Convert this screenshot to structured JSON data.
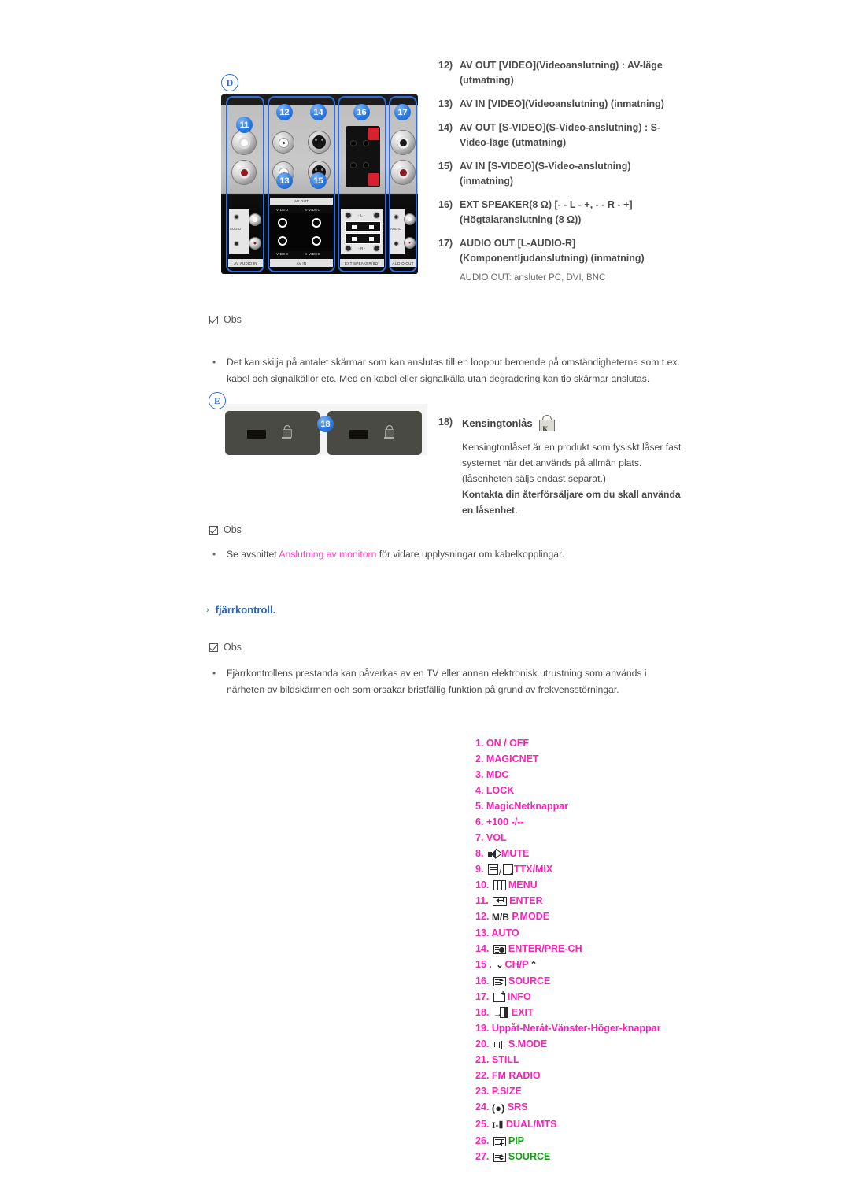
{
  "section_d": {
    "letter": "D",
    "panel": {
      "callouts": [
        "11",
        "12",
        "14",
        "16",
        "17",
        "13",
        "15"
      ],
      "labels": {
        "av_out": "AV OUT",
        "video": "VIDEO",
        "s_video": "S-VIDEO",
        "audio": "AUDIO",
        "l": "L",
        "r": "R",
        "av_audio_in": "AV AUDIO IN",
        "av_in": "AV IN",
        "ext_speaker": "EXT SPEAKER(8Ω)",
        "audio_out": "AUDIO OUT",
        "spk_l": "- L -",
        "spk_r": "- R -"
      }
    },
    "items": [
      {
        "num": "12)",
        "main": "AV OUT [VIDEO](Videoanslutning) : AV-läge",
        "cont": "(utmatning)"
      },
      {
        "num": "13)",
        "main": "AV IN [VIDEO](Videoanslutning) (inmatning)",
        "cont": ""
      },
      {
        "num": "14)",
        "main": "AV OUT [S-VIDEO](S-Video-anslutning) : S-",
        "cont": "Video-läge (utmatning)"
      },
      {
        "num": "15)",
        "main": "AV IN [S-VIDEO](S-Video-anslutning)",
        "cont": "(inmatning)"
      },
      {
        "num": "16)",
        "main": "EXT SPEAKER(8 Ω) [- - L - +, - - R - +]",
        "cont": "(Högtalaranslutning (8 Ω))"
      },
      {
        "num": "17)",
        "main": "AUDIO OUT [L-AUDIO-R]",
        "cont": "(Komponentljudanslutning) (inmatning)",
        "subnote": "AUDIO OUT: ansluter PC, DVI, BNC"
      }
    ]
  },
  "note_1": {
    "label": "Obs",
    "bullet": "•",
    "line1": "Det kan skilja på antalet skärmar som kan anslutas till en loopout beroende på omständigheterna som t.ex.",
    "line2": "kabel och signalkällor etc. Med en kabel eller signalkälla utan degradering kan tio skärmar anslutas."
  },
  "section_e": {
    "letter": "E",
    "callout": "18",
    "item": {
      "num": "18)",
      "title": "Kensingtonlås",
      "lock_icon": "kensington-lock-icon",
      "p1": "Kensingtonlåset är en produkt som fysiskt låser fast",
      "p2": "systemet när det används på allmän plats.",
      "p3": "(låsenheten säljs endast separat.)",
      "bold1": "Kontakta din återförsäljare om du skall använda",
      "bold2": "en låsenhet."
    }
  },
  "note_2": {
    "label": "Obs",
    "bullet": "•",
    "pre": "Se avsnittet ",
    "link": "Anslutning av monitorn",
    "post": " för vidare upplysningar om kabelkopplingar."
  },
  "remote_heading": {
    "marker": "›",
    "title": "fjärrkontroll."
  },
  "note_3": {
    "label": "Obs",
    "bullet": "•",
    "line1": "Fjärrkontrollens prestanda kan påverkas av en TV eller annan elektronisk utrustning som används i",
    "line2": "närheten av bildskärmen och som orsakar bristfällig funktion på grund av frekvensstörningar."
  },
  "colors": {
    "magenta": "#ff1fb9",
    "green": "#10a010",
    "link_pink": "#ff3fc6",
    "heading_blue": "#2a63b8",
    "badge_blue": "#2d7ae0"
  },
  "remote_keys": [
    {
      "num": "1.",
      "label": "ON / OFF",
      "icon": null,
      "color": "magenta"
    },
    {
      "num": "2.",
      "label": "MAGICNET",
      "icon": null,
      "color": "magenta"
    },
    {
      "num": "3.",
      "label": "MDC",
      "icon": null,
      "color": "magenta"
    },
    {
      "num": "4.",
      "label": "LOCK",
      "icon": null,
      "color": "magenta"
    },
    {
      "num": "5.",
      "label": "MagicNetknappar",
      "icon": null,
      "color": "magenta"
    },
    {
      "num": "6.",
      "label": "+100 -/--",
      "icon": null,
      "color": "magenta"
    },
    {
      "num": "7.",
      "label": "VOL",
      "icon": null,
      "color": "magenta"
    },
    {
      "num": "8.",
      "label": "MUTE",
      "icon": "mute-icon",
      "color": "magenta"
    },
    {
      "num": "9.",
      "label": "TTX/MIX",
      "icon": "ttx-mix-icon",
      "color": "magenta"
    },
    {
      "num": "10.",
      "label": "MENU",
      "icon": "menu-icon",
      "color": "magenta"
    },
    {
      "num": "11.",
      "label": "ENTER",
      "icon": "enter-icon",
      "color": "magenta"
    },
    {
      "num": "12.",
      "label": "P.MODE",
      "icon": "mb-icon",
      "color": "magenta"
    },
    {
      "num": "13.",
      "label": "AUTO",
      "icon": null,
      "color": "magenta"
    },
    {
      "num": "14.",
      "label": "ENTER/PRE-CH",
      "icon": "pre-ch-icon",
      "color": "magenta"
    },
    {
      "num": "15 .",
      "label": "CH/P",
      "icon": "chevrons-icon",
      "color": "magenta"
    },
    {
      "num": "16.",
      "label": "SOURCE",
      "icon": "source-icon",
      "color": "magenta"
    },
    {
      "num": "17.",
      "label": "INFO",
      "icon": "info-icon",
      "color": "magenta"
    },
    {
      "num": "18.",
      "label": "EXIT",
      "icon": "exit-icon",
      "color": "magenta"
    },
    {
      "num": "19.",
      "label": "Uppåt-Neråt-Vänster-Höger-knappar",
      "icon": null,
      "color": "magenta"
    },
    {
      "num": "20.",
      "label": "S.MODE",
      "icon": "s-mode-icon",
      "color": "magenta"
    },
    {
      "num": "21.",
      "label": "STILL",
      "icon": null,
      "color": "magenta"
    },
    {
      "num": "22.",
      "label": "FM RADIO",
      "icon": null,
      "color": "magenta"
    },
    {
      "num": "23.",
      "label": "P.SIZE",
      "icon": null,
      "color": "magenta"
    },
    {
      "num": "24.",
      "label": "SRS",
      "icon": "srs-icon",
      "color": "magenta"
    },
    {
      "num": "25.",
      "label": "DUAL/MTS",
      "icon": "dual-mts-icon",
      "color": "magenta"
    },
    {
      "num": "26.",
      "label": "PIP",
      "icon": "pip-icon",
      "color": "green"
    },
    {
      "num": "27.",
      "label": "SOURCE",
      "icon": "source2-icon",
      "color": "green"
    }
  ]
}
